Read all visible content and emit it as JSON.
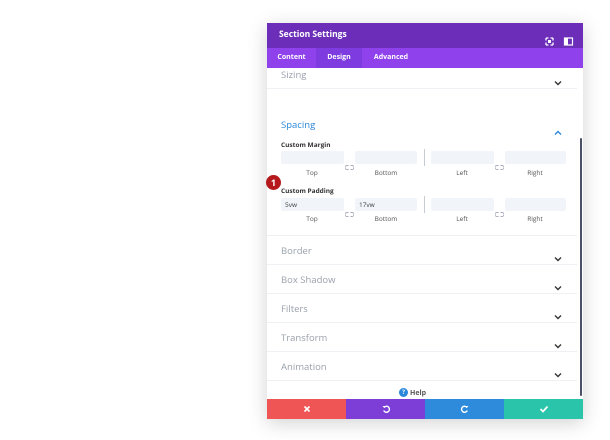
{
  "modal": {
    "title": "Section Settings",
    "tabs": [
      {
        "label": "Content"
      },
      {
        "label": "Design"
      },
      {
        "label": "Advanced"
      }
    ]
  },
  "sections": {
    "sizing": "Sizing",
    "spacing": "Spacing",
    "border": "Border",
    "box_shadow": "Box Shadow",
    "filters": "Filters",
    "transform": "Transform",
    "animation": "Animation"
  },
  "spacing": {
    "margin_label": "Custom Margin",
    "padding_label": "Custom Padding",
    "captions": {
      "top": "Top",
      "bottom": "Bottom",
      "left": "Left",
      "right": "Right"
    },
    "margin_values": {
      "top": "",
      "bottom": "",
      "left": "",
      "right": ""
    },
    "padding_values": {
      "top": "5vw",
      "bottom": "17vw",
      "left": "",
      "right": ""
    }
  },
  "help": {
    "label": "Help"
  },
  "badge": {
    "number": "1"
  },
  "colors": {
    "header": "#6c2eb9",
    "tabs": "#8f42ec",
    "cancel": "#ef5555",
    "undo": "#7c3ed6",
    "redo": "#2e8bdb",
    "save": "#29c4a9",
    "accent": "#2b87da",
    "badge": "#b5191c"
  },
  "icons": {
    "expand": "expand-icon",
    "split": "split-view-icon",
    "chevron": "chevron-down-icon",
    "link": "link-icon",
    "cancel": "close-icon",
    "undo": "undo-icon",
    "redo": "redo-icon",
    "save": "checkmark-icon"
  }
}
